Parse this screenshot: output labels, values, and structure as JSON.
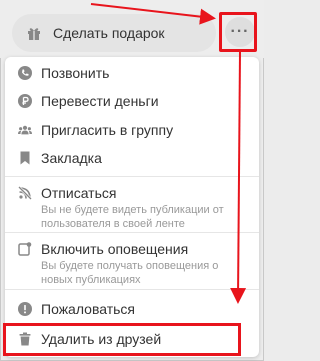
{
  "top": {
    "gift_label": "Сделать подарок",
    "more_label": "···"
  },
  "menu": {
    "items": [
      {
        "label": "Позвонить",
        "sub": "",
        "icon": "phone-icon"
      },
      {
        "label": "Перевести деньги",
        "sub": "",
        "icon": "ruble-icon"
      },
      {
        "label": "Пригласить в группу",
        "sub": "",
        "icon": "group-icon"
      },
      {
        "label": "Закладка",
        "sub": "",
        "icon": "bookmark-icon"
      },
      {
        "label": "Отписаться",
        "sub": "Вы не будете видеть публикации от пользователя в своей ленте",
        "icon": "unsubscribe-icon"
      },
      {
        "label": "Включить оповещения",
        "sub": "Вы будете получать оповещения о новых публикациях",
        "icon": "notification-icon"
      },
      {
        "label": "Пожаловаться",
        "sub": "",
        "icon": "warning-icon"
      },
      {
        "label": "Удалить из друзей",
        "sub": "",
        "icon": "trash-icon"
      }
    ]
  },
  "colors": {
    "annotation": "#e8141c",
    "icon": "#888888"
  }
}
